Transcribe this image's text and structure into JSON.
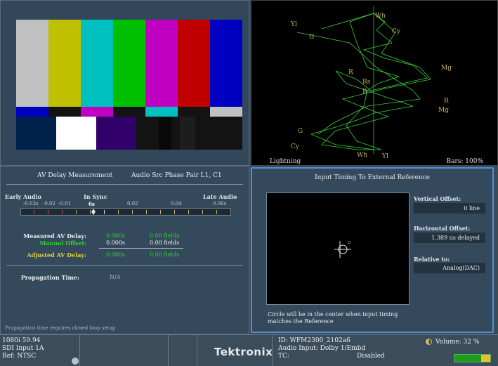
{
  "bars_pane": {
    "top_bars": [
      "#c0c0c0",
      "#c0c000",
      "#00c0c0",
      "#00c000",
      "#c000c0",
      "#c00000",
      "#0000c0"
    ],
    "mid_bars": [
      "#0000c0",
      "#131313",
      "#c000c0",
      "#131313",
      "#00c0c0",
      "#131313",
      "#c0c0c0"
    ],
    "bottom_bars": [
      "#00214c",
      "#ffffff",
      "#32006a",
      "#131313",
      "#090909",
      "#131313",
      "#1d1d1d",
      "#131313"
    ]
  },
  "lightning": {
    "name": "Lightning",
    "bars_label": "Bars: 100%",
    "labels": [
      "Yl",
      "Wh",
      "Cy",
      "G",
      "Mg",
      "R",
      "Rs",
      "B",
      "R",
      "Mg",
      "G",
      "Cy",
      "Wh",
      "Yl"
    ]
  },
  "av_delay": {
    "title": "AV Delay Measurement",
    "pair_label": "Audio Src Phase Pair  L1, C1",
    "early_audio": "Early Audio",
    "in_sync": "In Sync",
    "late_audio": "Late Audio",
    "scale_ticks": [
      "-0.03s",
      "-0.02",
      "-0.01",
      "0s",
      "0.02",
      "0.04",
      "0.06s"
    ],
    "measured_label": "Measured AV Delay:",
    "measured_seconds": "0.000s",
    "measured_fields": "0.00 fields",
    "manual_label": "Manual Offset:",
    "manual_seconds": "0.000s",
    "manual_fields": "0.00 fields",
    "adjusted_label": "Adjusted AV Delay:",
    "adjusted_seconds": "0.000s",
    "adjusted_fields": "0.00 fields",
    "propagation_label": "Propagation Time:",
    "propagation_value": "N/A",
    "footer_note": "Propagation time requires closed loop setup"
  },
  "timing": {
    "title": "Input Timing To External Reference",
    "vertical_label": "Vertical Offset:",
    "vertical_value": "0 line",
    "horizontal_label": "Horizontal Offset:",
    "horizontal_value": "1.389 us delayed",
    "relative_label": "Relative to:",
    "relative_value": "Analog(DAC)",
    "note": "Circle will be in the center when input timing matches the Reference"
  },
  "status": {
    "format": "1080i 59.94",
    "input": "SDI Input 1A",
    "ref": "Ref: NTSC",
    "brand": "Tektronix",
    "id": "ID: WFM2300_2102a6",
    "audio_input": "Audio Input: Dolby 1/Embd",
    "tc_label": "TC:",
    "tc_value": "Disabled",
    "volume": "Volume:  32 %",
    "volume_level": 0.32
  }
}
